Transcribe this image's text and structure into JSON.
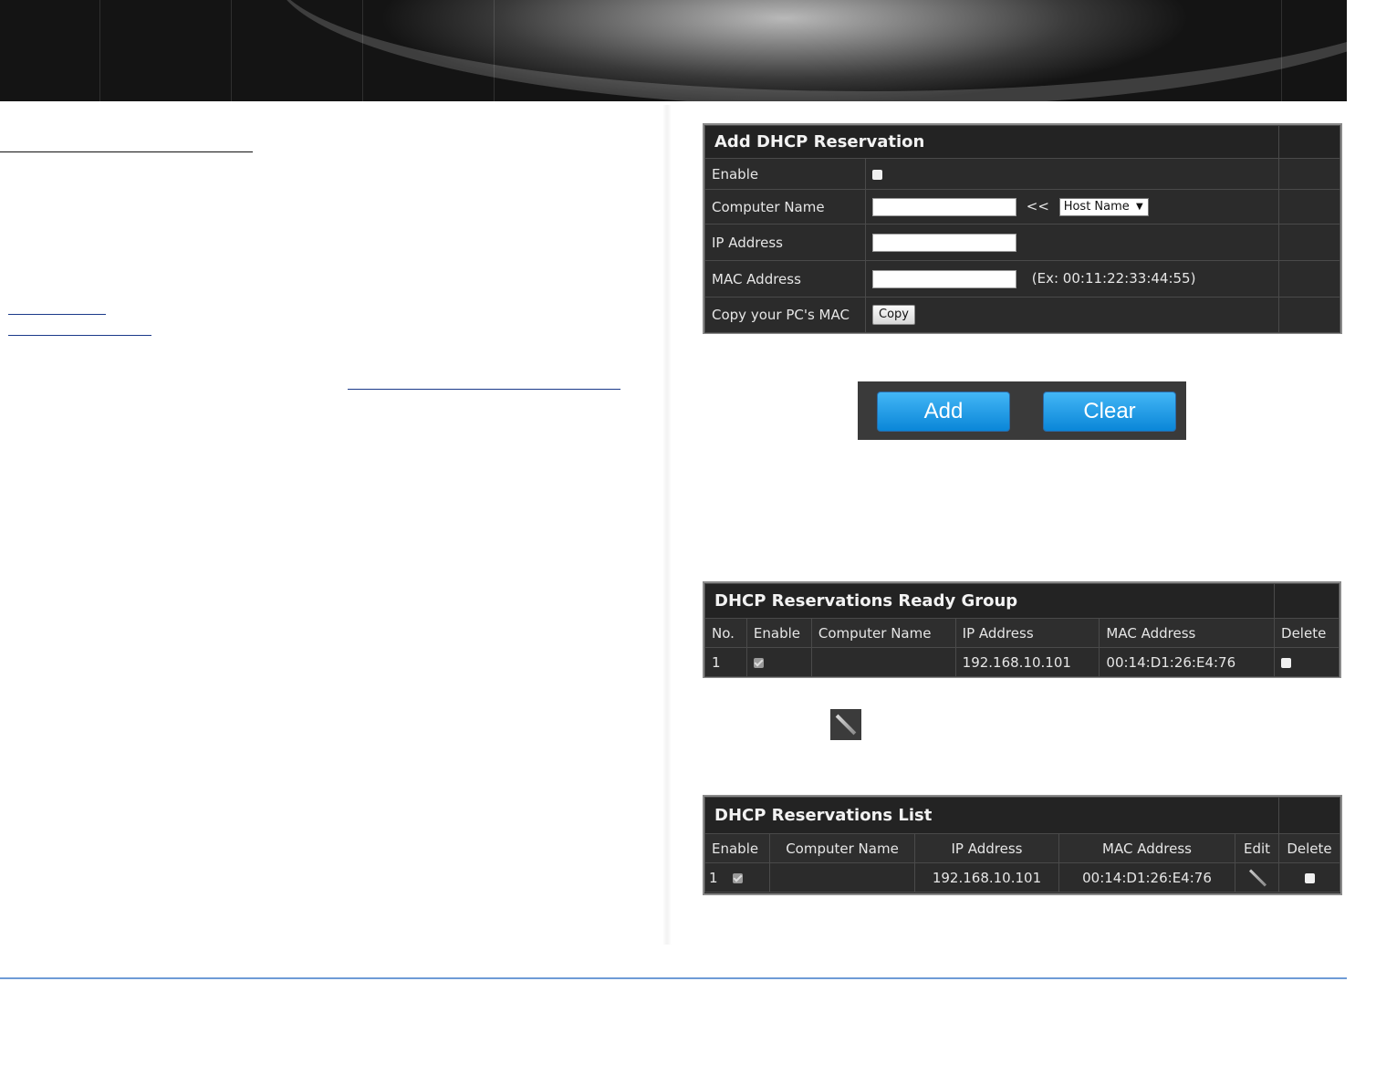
{
  "add_reservation": {
    "title": "Add DHCP Reservation",
    "rows": {
      "enable_label": "Enable",
      "computer_name_label": "Computer Name",
      "host_separator": "<<",
      "host_select": "Host Name",
      "ip_label": "IP Address",
      "mac_label": "MAC Address",
      "mac_example": "(Ex: 00:11:22:33:44:55)",
      "copy_label": "Copy your PC's MAC",
      "copy_button": "Copy"
    }
  },
  "actions": {
    "add": "Add",
    "clear": "Clear"
  },
  "ready_group": {
    "title": "DHCP Reservations Ready Group",
    "headers": [
      "No.",
      "Enable",
      "Computer Name",
      "IP Address",
      "MAC Address",
      "Delete"
    ],
    "row": {
      "no": "1",
      "computer_name": "",
      "ip": "192.168.10.101",
      "mac": "00:14:D1:26:E4:76"
    }
  },
  "reservations_list": {
    "title": "DHCP Reservations List",
    "headers": [
      "Enable",
      "Computer Name",
      "IP Address",
      "MAC Address",
      "Edit",
      "Delete"
    ],
    "row": {
      "no": "1",
      "computer_name": "",
      "ip": "192.168.10.101",
      "mac": "00:14:D1:26:E4:76"
    }
  },
  "colors": {
    "accent_blue": "#0a86d8",
    "panel_bg": "#2b2b2b"
  },
  "icons": [
    "pencil-icon",
    "checkbox"
  ]
}
